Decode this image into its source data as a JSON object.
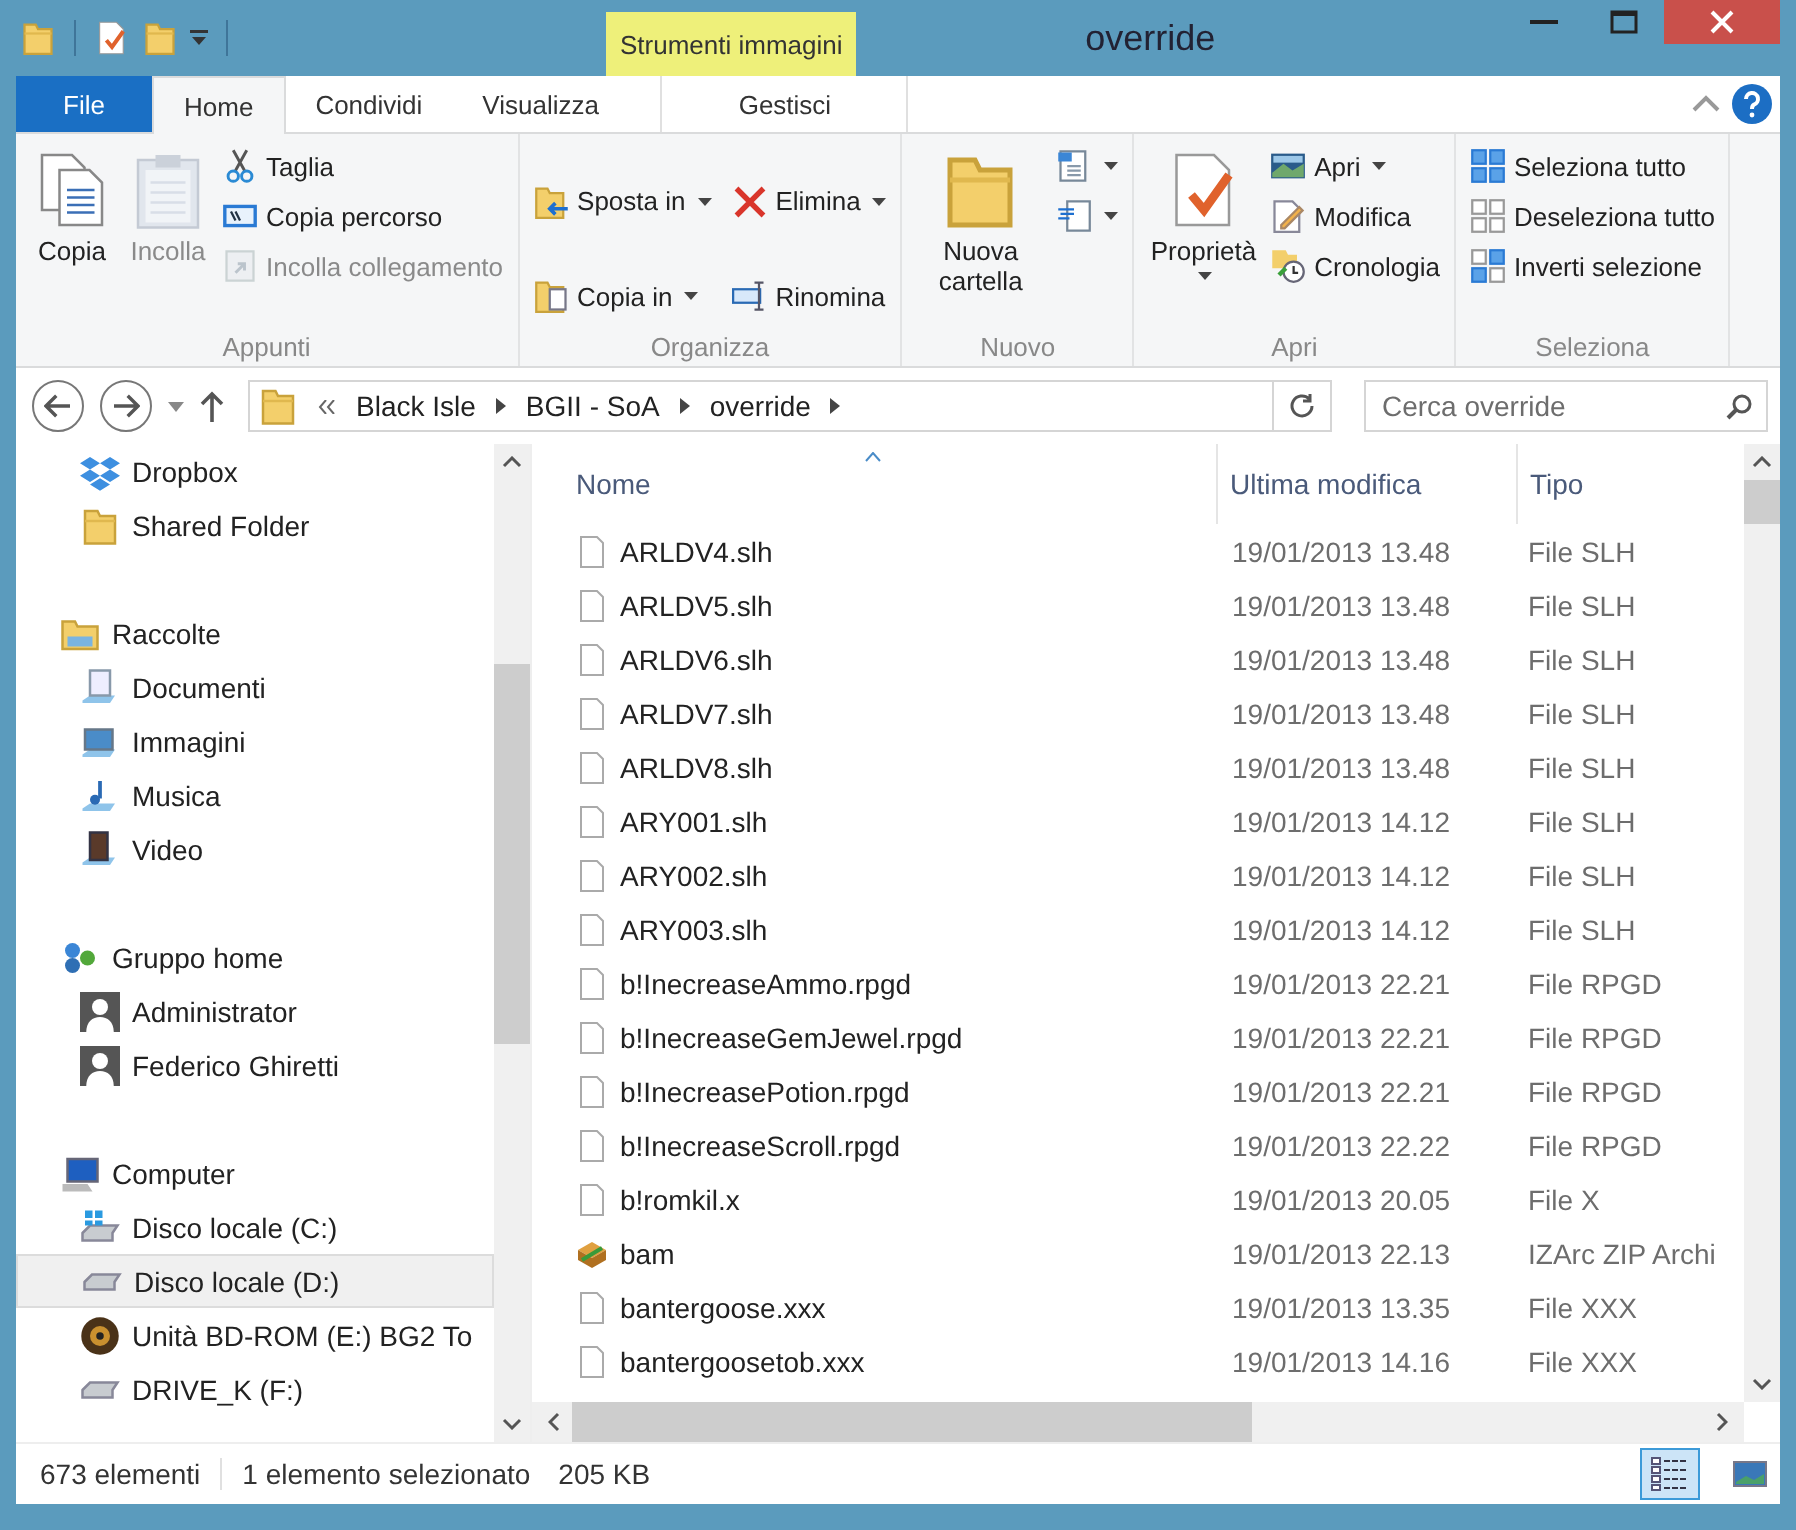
{
  "window": {
    "title": "override",
    "context_tab_group": "Strumenti immagini"
  },
  "tabs": [
    {
      "label": "File",
      "kind": "file",
      "selected": false
    },
    {
      "label": "Home",
      "kind": "tab",
      "selected": true
    },
    {
      "label": "Condividi",
      "kind": "tab",
      "selected": false
    },
    {
      "label": "Visualizza",
      "kind": "tab",
      "selected": false
    },
    {
      "label": "Gestisci",
      "kind": "context",
      "selected": false
    }
  ],
  "ribbon": [
    {
      "label": "Appunti",
      "large": [
        {
          "label": "Copia",
          "kind": "copy",
          "disabled": false,
          "dropdown": false
        },
        {
          "label": "Incolla",
          "kind": "paste",
          "disabled": true,
          "dropdown": false
        }
      ],
      "small": [
        {
          "label": "Taglia",
          "kind": "scissors",
          "disabled": false,
          "dropdown": false
        },
        {
          "label": "Copia percorso",
          "kind": "path",
          "disabled": false,
          "dropdown": false
        },
        {
          "label": "Incolla collegamento",
          "kind": "shortcut",
          "disabled": true,
          "dropdown": false
        }
      ]
    },
    {
      "label": "Organizza",
      "small": [
        {
          "label": "Sposta in",
          "kind": "move",
          "disabled": false,
          "dropdown": true
        },
        {
          "label": "Copia in",
          "kind": "copyto",
          "disabled": false,
          "dropdown": true
        },
        {
          "label": "Elimina",
          "kind": "delete",
          "disabled": false,
          "dropdown": true
        },
        {
          "label": "Rinomina",
          "kind": "rename",
          "disabled": false,
          "dropdown": false
        }
      ]
    },
    {
      "label": "Nuovo",
      "large": [
        {
          "label": "Nuova cartella",
          "kind": "folder",
          "disabled": false,
          "dropdown": false
        }
      ],
      "small": [
        {
          "kind": "newitem",
          "disabled": false,
          "dropdown": true
        },
        {
          "kind": "easyaccess",
          "disabled": false,
          "dropdown": true
        }
      ]
    },
    {
      "label": "Apri",
      "large": [
        {
          "label": "Proprietà",
          "kind": "properties",
          "disabled": false,
          "dropdown": true
        }
      ],
      "small": [
        {
          "label": "Apri",
          "kind": "image",
          "disabled": false,
          "dropdown": true
        },
        {
          "label": "Modifica",
          "kind": "edit",
          "disabled": false,
          "dropdown": false
        },
        {
          "label": "Cronologia",
          "kind": "history",
          "disabled": false,
          "dropdown": false
        }
      ]
    },
    {
      "label": "Seleziona",
      "small": [
        {
          "label": "Seleziona tutto",
          "kind": "selall",
          "disabled": false,
          "dropdown": false
        },
        {
          "label": "Deseleziona tutto",
          "kind": "selnone",
          "disabled": false,
          "dropdown": false
        },
        {
          "label": "Inverti selezione",
          "kind": "selinv",
          "disabled": false,
          "dropdown": false
        }
      ]
    }
  ],
  "address": {
    "path": [
      "Black Isle",
      "BGII - SoA",
      "override"
    ],
    "search_placeholder": "Cerca override"
  },
  "sidebar": [
    {
      "children": [
        {
          "label": "Dropbox",
          "kind": "dropbox",
          "selected": false
        },
        {
          "label": "Shared Folder",
          "kind": "folder",
          "selected": false
        }
      ]
    },
    {
      "label": "Raccolte",
      "kind": "library",
      "selected": false,
      "children": [
        {
          "label": "Documenti",
          "kind": "documents",
          "selected": false
        },
        {
          "label": "Immagini",
          "kind": "pictures",
          "selected": false
        },
        {
          "label": "Musica",
          "kind": "music",
          "selected": false
        },
        {
          "label": "Video",
          "kind": "video",
          "selected": false
        }
      ]
    },
    {
      "label": "Gruppo home",
      "kind": "homegroup",
      "selected": false,
      "children": [
        {
          "label": "Administrator",
          "kind": "user",
          "selected": false
        },
        {
          "label": "Federico Ghiretti",
          "kind": "user",
          "selected": false
        }
      ]
    },
    {
      "label": "Computer",
      "kind": "computer",
      "selected": false,
      "children": [
        {
          "label": "Disco locale (C:)",
          "kind": "windrive",
          "selected": false
        },
        {
          "label": "Disco locale (D:)",
          "kind": "drive",
          "selected": true
        },
        {
          "label": "Unità BD-ROM (E:) BG2 To",
          "kind": "disc",
          "selected": false
        },
        {
          "label": "DRIVE_K (F:)",
          "kind": "drive",
          "selected": false
        }
      ]
    }
  ],
  "table": {
    "columns": [
      "Nome",
      "Ultima modifica",
      "Tipo"
    ],
    "rows": [
      {
        "name": "ARLDV4.slh",
        "modified": "19/01/2013 13.48",
        "type": "File SLH",
        "kind": "file",
        "selected": false
      },
      {
        "name": "ARLDV5.slh",
        "modified": "19/01/2013 13.48",
        "type": "File SLH",
        "kind": "file",
        "selected": false
      },
      {
        "name": "ARLDV6.slh",
        "modified": "19/01/2013 13.48",
        "type": "File SLH",
        "kind": "file",
        "selected": false
      },
      {
        "name": "ARLDV7.slh",
        "modified": "19/01/2013 13.48",
        "type": "File SLH",
        "kind": "file",
        "selected": false
      },
      {
        "name": "ARLDV8.slh",
        "modified": "19/01/2013 13.48",
        "type": "File SLH",
        "kind": "file",
        "selected": false
      },
      {
        "name": "ARY001.slh",
        "modified": "19/01/2013 14.12",
        "type": "File SLH",
        "kind": "file",
        "selected": false
      },
      {
        "name": "ARY002.slh",
        "modified": "19/01/2013 14.12",
        "type": "File SLH",
        "kind": "file",
        "selected": false
      },
      {
        "name": "ARY003.slh",
        "modified": "19/01/2013 14.12",
        "type": "File SLH",
        "kind": "file",
        "selected": false
      },
      {
        "name": "b!InecreaseAmmo.rpgd",
        "modified": "19/01/2013 22.21",
        "type": "File RPGD",
        "kind": "file",
        "selected": false
      },
      {
        "name": "b!InecreaseGemJewel.rpgd",
        "modified": "19/01/2013 22.21",
        "type": "File RPGD",
        "kind": "file",
        "selected": false
      },
      {
        "name": "b!InecreasePotion.rpgd",
        "modified": "19/01/2013 22.21",
        "type": "File RPGD",
        "kind": "file",
        "selected": false
      },
      {
        "name": "b!InecreaseScroll.rpgd",
        "modified": "19/01/2013 22.22",
        "type": "File RPGD",
        "kind": "file",
        "selected": false
      },
      {
        "name": "b!romkil.x",
        "modified": "19/01/2013 20.05",
        "type": "File X",
        "kind": "file",
        "selected": false
      },
      {
        "name": "bam",
        "modified": "19/01/2013 22.13",
        "type": "IZArc ZIP Archi",
        "kind": "archive",
        "selected": false
      },
      {
        "name": "bantergoose.xxx",
        "modified": "19/01/2013 13.35",
        "type": "File XXX",
        "kind": "file",
        "selected": false
      },
      {
        "name": "bantergoosetob.xxx",
        "modified": "19/01/2013 14.16",
        "type": "File XXX",
        "kind": "file",
        "selected": false
      }
    ]
  },
  "status_bar": {
    "count": "673 elementi",
    "selection": "1 elemento selezionato",
    "size": "205 KB",
    "views": [
      {
        "kind": "details",
        "selected": true
      },
      {
        "kind": "large",
        "selected": false
      }
    ]
  }
}
